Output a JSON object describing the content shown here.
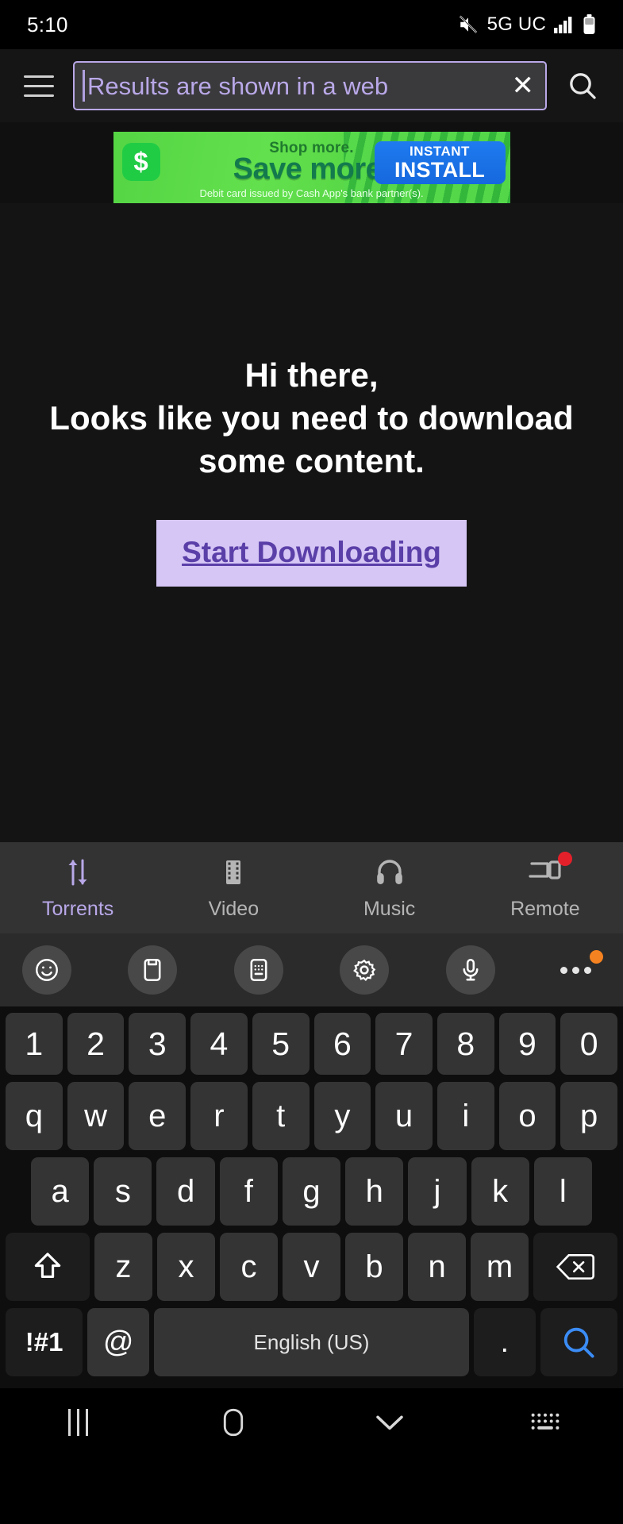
{
  "status_bar": {
    "time": "5:10",
    "network": "5G UC",
    "icons": [
      "mute-icon",
      "signal-bars-icon",
      "battery-icon"
    ]
  },
  "app_bar": {
    "menu_icon": "hamburger-menu-icon",
    "search_value": "Results are shown in a web",
    "search_placeholder": "Results are shown in a web",
    "clear_label": "✕",
    "search_icon": "magnifier-icon"
  },
  "ad": {
    "brand": "$",
    "line1": "Shop more.",
    "line2": "Save more.",
    "disclaimer": "Debit card issued by Cash App's bank partner(s).",
    "cta_top": "INSTANT",
    "cta_main": "INSTALL"
  },
  "page": {
    "heading_line1": "Hi there,",
    "heading_line2": "Looks like you need to download",
    "heading_line3": "some content.",
    "download_button": "Start Downloading"
  },
  "tabs": [
    {
      "label": "Torrents",
      "icon": "transfer-arrows-icon",
      "active": true,
      "badge": false
    },
    {
      "label": "Video",
      "icon": "film-strip-icon",
      "active": false,
      "badge": false
    },
    {
      "label": "Music",
      "icon": "headphones-icon",
      "active": false,
      "badge": false
    },
    {
      "label": "Remote",
      "icon": "remote-devices-icon",
      "active": false,
      "badge": true
    }
  ],
  "keyboard_toolbar": [
    {
      "icon": "emoji-smiley-icon"
    },
    {
      "icon": "clipboard-icon"
    },
    {
      "icon": "keyboard-layout-icon"
    },
    {
      "icon": "settings-gear-icon"
    },
    {
      "icon": "microphone-icon"
    },
    {
      "icon": "more-options-icon",
      "badge": true
    }
  ],
  "keyboard": {
    "row_numbers": [
      "1",
      "2",
      "3",
      "4",
      "5",
      "6",
      "7",
      "8",
      "9",
      "0"
    ],
    "row_top": [
      "q",
      "w",
      "e",
      "r",
      "t",
      "y",
      "u",
      "i",
      "o",
      "p"
    ],
    "row_home": [
      "a",
      "s",
      "d",
      "f",
      "g",
      "h",
      "j",
      "k",
      "l"
    ],
    "row_bottom": [
      "z",
      "x",
      "c",
      "v",
      "b",
      "n",
      "m"
    ],
    "shift_icon": "shift-arrow-icon",
    "backspace_icon": "backspace-icon",
    "symbols_label": "!#1",
    "at_label": "@",
    "space_label": "English (US)",
    "period_label": ".",
    "enter_icon": "search-magnifier-icon"
  },
  "nav_bar": [
    {
      "icon": "recent-apps-icon"
    },
    {
      "icon": "home-icon"
    },
    {
      "icon": "dismiss-keyboard-chevron-icon"
    },
    {
      "icon": "keyboard-switch-icon"
    }
  ],
  "colors": {
    "accent_purple": "#b9a8e8",
    "button_bg": "#d5c6f5",
    "button_text": "#5b3fa8",
    "badge_red": "#e4202a",
    "badge_orange": "#f58220",
    "enter_blue": "#3b8cf5"
  }
}
